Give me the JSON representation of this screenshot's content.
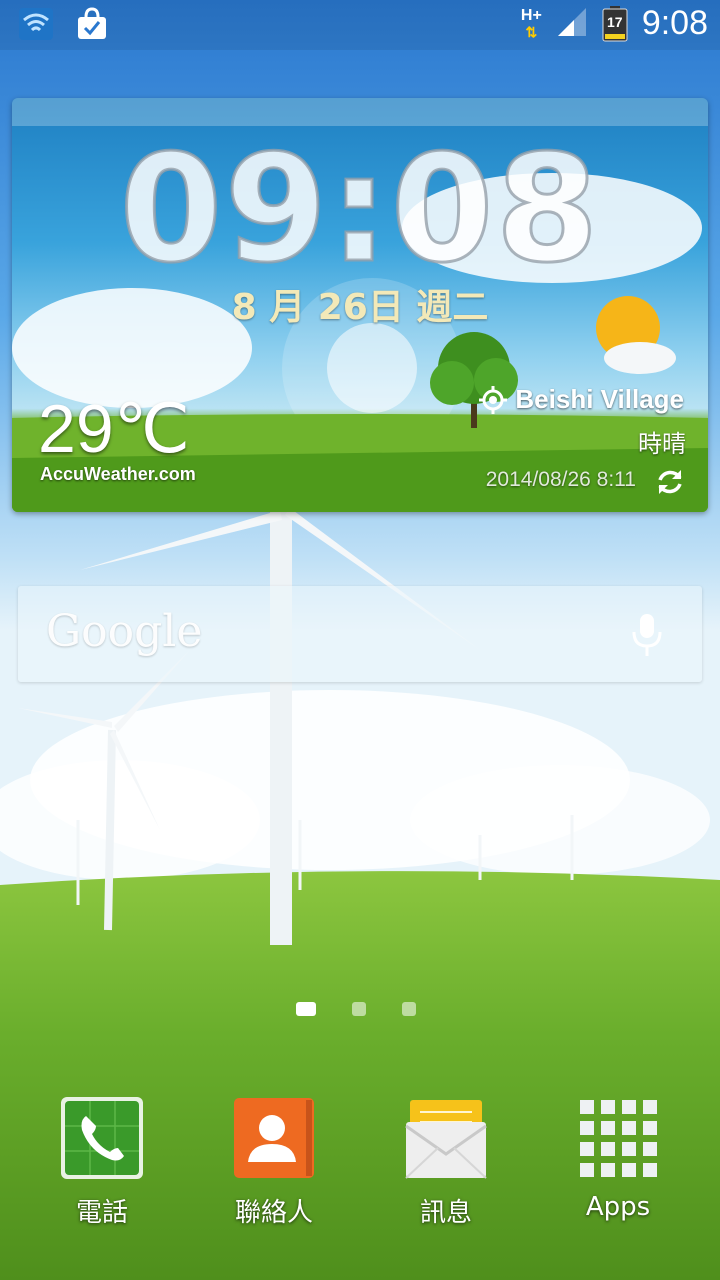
{
  "status_bar": {
    "network_type": "H+",
    "notification_badge": "17",
    "time": "9:08",
    "icons": [
      "wifi-icon",
      "shopping-bag-icon",
      "data-arrows-icon",
      "signal-icon",
      "battery-icon"
    ]
  },
  "widget": {
    "clock": "09:08",
    "date": "8 月 26日 週二",
    "temperature": "29℃",
    "provider": "AccuWeather.com",
    "location": "Beishi Village",
    "condition": "時晴",
    "updated": "2014/08/26 8:11"
  },
  "search": {
    "logo": "Google"
  },
  "pager": {
    "page_count": 3,
    "active_page": 1
  },
  "dock": {
    "items": [
      {
        "label": "電話",
        "icon": "phone-icon"
      },
      {
        "label": "聯絡人",
        "icon": "contacts-icon"
      },
      {
        "label": "訊息",
        "icon": "messages-icon"
      },
      {
        "label": "Apps",
        "icon": "apps-grid-icon"
      }
    ]
  },
  "colors": {
    "date_text": "#f3e9b8",
    "phone_green": "#3a9a2a",
    "contacts_orange": "#ee6a21",
    "message_yellow": "#f6c21a"
  }
}
